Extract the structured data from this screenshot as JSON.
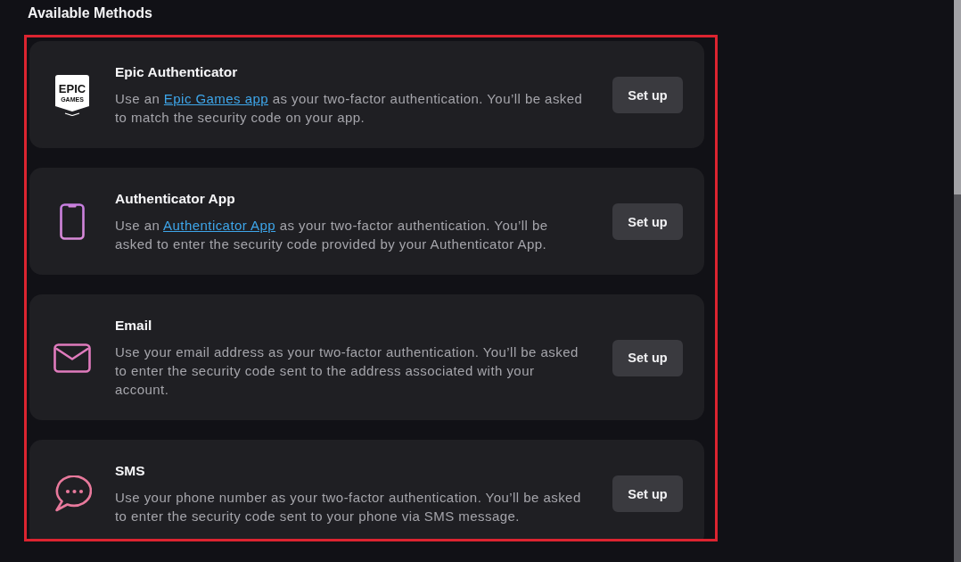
{
  "heading": "Available Methods",
  "highlight_frame": true,
  "methods": [
    {
      "kind": "logo",
      "logo_text": [
        "EPIC",
        "GAMES"
      ],
      "title": "Epic Authenticator",
      "description": [
        {
          "kind": "text",
          "text": "Use an "
        },
        {
          "kind": "link",
          "text": "Epic Games app"
        },
        {
          "kind": "text",
          "text": " as your two-factor authentication. You’ll be asked to match the security code on your app."
        }
      ],
      "button": "Set up"
    },
    {
      "kind": "phone",
      "title": "Authenticator App",
      "description": [
        {
          "kind": "text",
          "text": "Use an "
        },
        {
          "kind": "link",
          "text": "Authenticator App"
        },
        {
          "kind": "text",
          "text": " as your two-factor authentication. You’ll be asked to enter the security code provided by your Authenticator App."
        }
      ],
      "button": "Set up"
    },
    {
      "kind": "mail",
      "title": "Email",
      "description": [
        {
          "kind": "text",
          "text": "Use your email address as your two-factor authentication. You’ll be asked to enter the security code sent to the address associated with your account."
        }
      ],
      "button": "Set up"
    },
    {
      "kind": "chat",
      "title": "SMS",
      "description": [
        {
          "kind": "text",
          "text": "Use your phone number as your two-factor authentication. You’ll be asked to enter the security code sent to your phone via SMS message."
        }
      ],
      "button": "Set up"
    }
  ]
}
